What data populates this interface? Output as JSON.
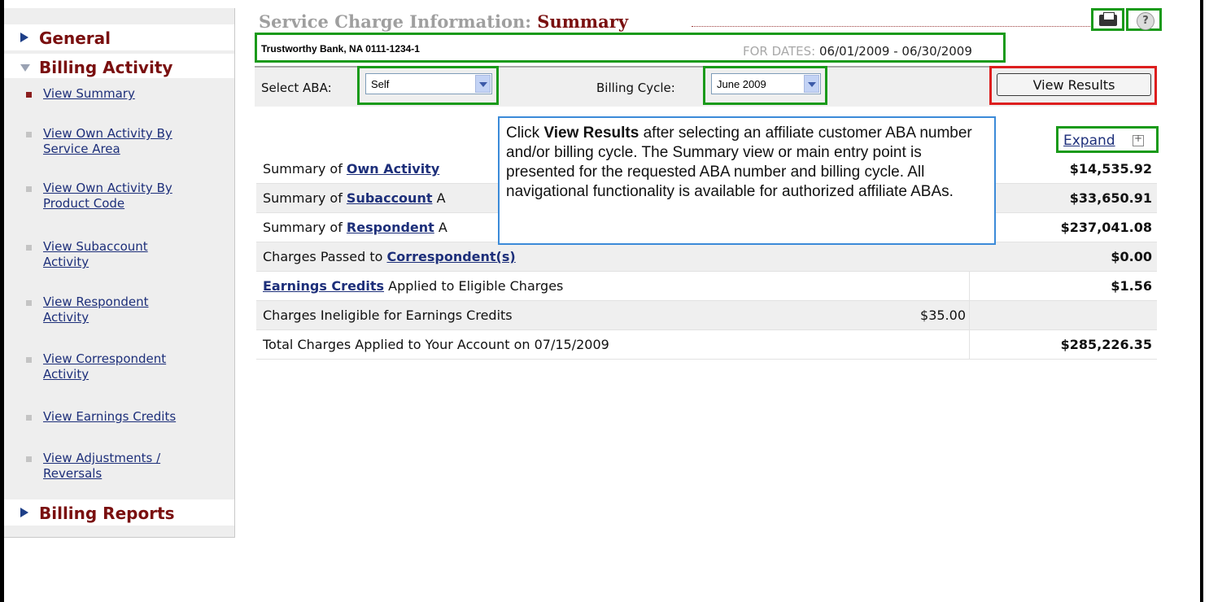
{
  "sidebar": {
    "sections": [
      {
        "label": "General"
      },
      {
        "label": "Billing Activity"
      },
      {
        "label": "Billing Reports"
      }
    ],
    "items": [
      {
        "label": "View Summary"
      },
      {
        "label": "View Own Activity By Service Area"
      },
      {
        "label": "View Own Activity By Product Code"
      },
      {
        "label": "View Subaccount Activity"
      },
      {
        "label": "View Respondent Activity"
      },
      {
        "label": "View Correspondent Activity"
      },
      {
        "label": "View Earnings Credits"
      },
      {
        "label": "View Adjustments / Reversals"
      }
    ]
  },
  "header": {
    "title_main": "Service Charge Information:",
    "title_sub": "Summary",
    "print_icon": "printer-icon",
    "help_icon": "help-icon",
    "help_glyph": "?"
  },
  "account": {
    "name": "Trustworthy Bank, NA 0111-1234-1",
    "dates_label": "FOR DATES:",
    "dates_value": "06/01/2009 - 06/30/2009"
  },
  "filters": {
    "aba_label": "Select ABA:",
    "aba_value": "Self",
    "cycle_label": "Billing Cycle:",
    "cycle_value": "June 2009",
    "results_button": "View Results"
  },
  "expand": {
    "label": "Expand"
  },
  "table": {
    "rows": [
      {
        "prefix": "Summary of ",
        "link": "Own Activity",
        "suffix": "",
        "amount": "$14,535.92"
      },
      {
        "prefix": "Summary of ",
        "link": "Subaccount",
        "suffix": " A",
        "amount": "$33,650.91"
      },
      {
        "prefix": "Summary of ",
        "link": "Respondent",
        "suffix": " A",
        "amount": "$237,041.08"
      },
      {
        "prefix": "Charges Passed to ",
        "link": "Correspondent(s)",
        "suffix": "",
        "amount": "$0.00"
      },
      {
        "prefix": "",
        "link": "Earnings Credits",
        "suffix": " Applied to Eligible Charges",
        "amount": "$1.56"
      },
      {
        "prefix": "Charges Ineligible for Earnings Credits",
        "link": "",
        "suffix": "",
        "mid": "$35.00",
        "amount": ""
      },
      {
        "prefix": "Total Charges Applied to Your Account on 07/15/2009",
        "link": "",
        "suffix": "",
        "amount": "$285,226.35"
      }
    ]
  },
  "tooltip": {
    "lead": "Click ",
    "bold": "View Results",
    "text": " after selecting an affiliate customer ABA number and/or billing cycle.  The Summary view or main entry point is presented for the requested ABA number and billing cycle.  All navigational functionality is available for authorized affiliate ABAs."
  },
  "colors": {
    "annotation_green": "#1a9a1a",
    "annotation_red": "#dd1e1e",
    "tooltip_border": "#3b8ad8",
    "section_label": "#7a1010",
    "link": "#1d2f7a"
  }
}
